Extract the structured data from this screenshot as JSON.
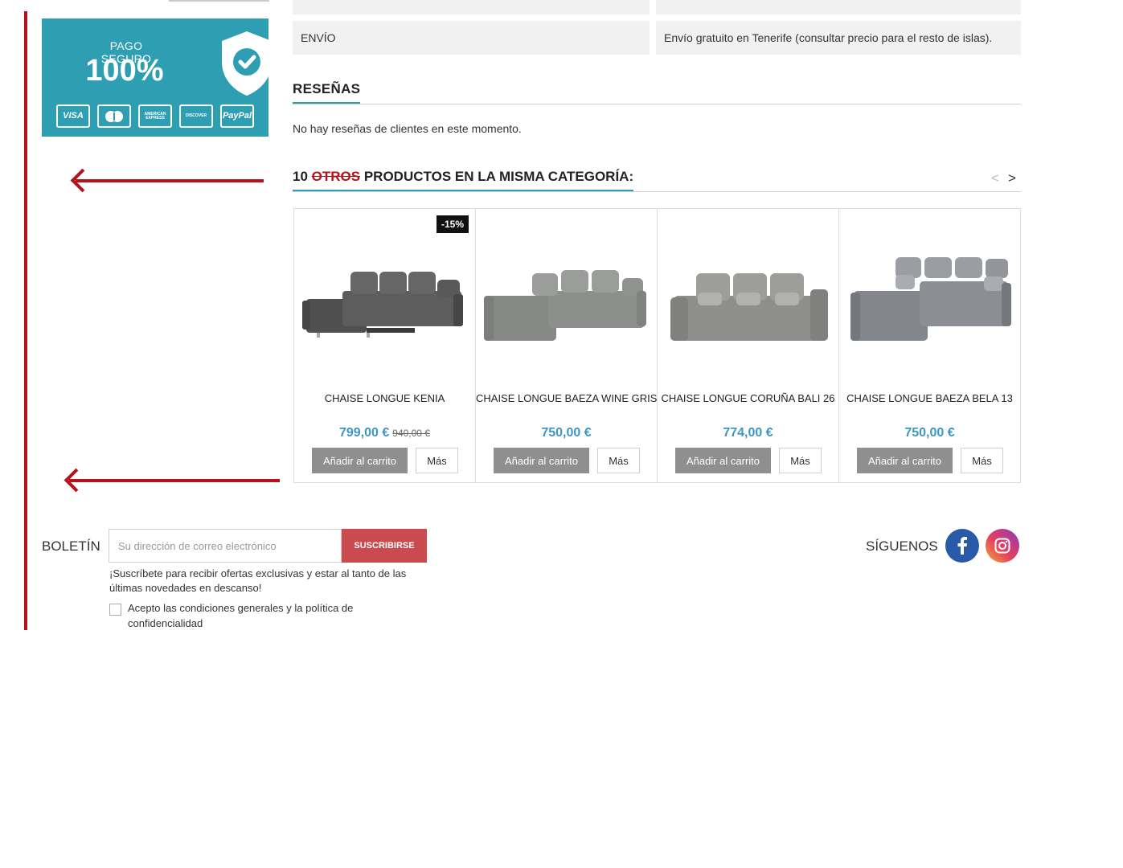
{
  "payment_badge": {
    "caption": "PAGO SEGURO",
    "percent": "100%",
    "cards": [
      "VISA",
      "",
      "AMERICAN EXPRESS",
      "DISCOVER",
      "PayPal"
    ]
  },
  "spec_table": {
    "row_label": "ENVÍO",
    "row_value": "Envío gratuito en Tenerife (consultar precio para el resto de islas)."
  },
  "reviews": {
    "title": "RESEÑAS",
    "text": "No hay reseñas de clientes en este momento."
  },
  "related": {
    "title_count": "10",
    "title_struck": "OTROS",
    "title_rest": "PRODUCTOS EN LA MISMA CATEGORÍA:",
    "prev_arrow": "<",
    "next_arrow": ">",
    "products": [
      {
        "name": "CHAISE LONGUE KENIA",
        "price": "799,00 €",
        "old_price": "940,00 €",
        "discount": "-15%",
        "add_label": "Añadir al carrito",
        "more_label": "Más",
        "color": "#585858"
      },
      {
        "name": "CHAISE LONGUE BAEZA WINE GRIS",
        "price": "750,00 €",
        "add_label": "Añadir al carrito",
        "more_label": "Más",
        "color": "#8c8f8c"
      },
      {
        "name": "CHAISE LONGUE CORUÑA BALI 26",
        "price": "774,00 €",
        "add_label": "Añadir al carrito",
        "more_label": "Más",
        "color": "#8e8f8c"
      },
      {
        "name": "CHAISE LONGUE BAEZA BELA 13",
        "price": "750,00 €",
        "add_label": "Añadir al carrito",
        "more_label": "Más",
        "color": "#8b8e93"
      }
    ]
  },
  "newsletter": {
    "label": "BOLETÍN",
    "placeholder": "Su dirección de correo electrónico",
    "button": "SUSCRIBIRSE",
    "description": "¡Suscríbete para recibir ofertas exclusivas y estar al tanto de las últimas novedades en descanso!",
    "consent": "Acepto las condiciones generales y la política de confidencialidad"
  },
  "social": {
    "label": "SÍGUENOS",
    "icons": [
      "facebook-icon",
      "instagram-icon"
    ]
  },
  "colors": {
    "accent": "#2e9fb3",
    "price": "#3d97c2",
    "subscribe": "#c94a4f",
    "annotation": "#b5121b"
  }
}
